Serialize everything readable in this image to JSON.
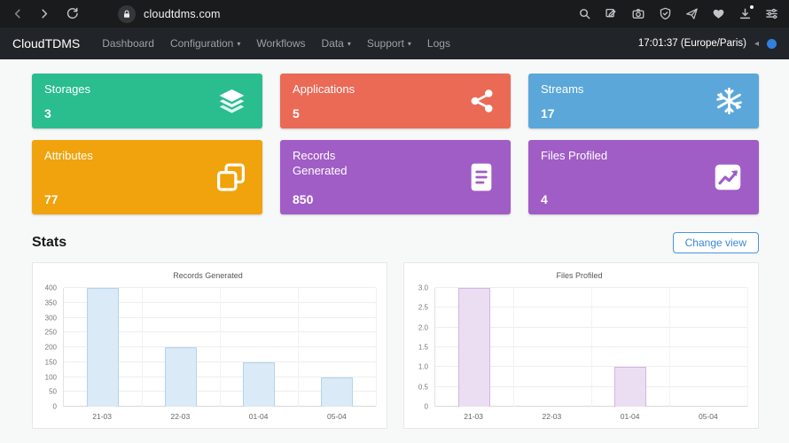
{
  "browser": {
    "url": "cloudtdms.com",
    "icons": [
      "back",
      "forward",
      "refresh",
      "lock",
      "search",
      "screenshot-edit",
      "camera",
      "shield",
      "send",
      "favorite",
      "download",
      "settings-sliders"
    ]
  },
  "navbar": {
    "brand": "CloudTDMS",
    "items": [
      {
        "label": "Dashboard"
      },
      {
        "label": "Configuration"
      },
      {
        "label": "Workflows"
      },
      {
        "label": "Data"
      },
      {
        "label": "Support"
      },
      {
        "label": "Logs"
      }
    ],
    "clock": "17:01:37 (Europe/Paris)"
  },
  "cards": [
    {
      "title": "Storages",
      "value": "3",
      "color": "#2abd8e",
      "icon": "layers-icon"
    },
    {
      "title": "Applications",
      "value": "5",
      "color": "#ea6a56",
      "icon": "nodes-icon"
    },
    {
      "title": "Streams",
      "value": "17",
      "color": "#5ba7da",
      "icon": "snowflake-icon"
    },
    {
      "title": "Attributes",
      "value": "77",
      "color": "#f0a30c",
      "icon": "clone-icon"
    },
    {
      "title": "Records Generated",
      "value": "850",
      "color": "#a05dc6",
      "icon": "file-text-icon"
    },
    {
      "title": "Files Profiled",
      "value": "4",
      "color": "#a05dc6",
      "icon": "chart-line-icon"
    }
  ],
  "stats": {
    "heading": "Stats",
    "change_view_label": "Change view"
  },
  "chart_data": [
    {
      "type": "bar",
      "title": "Records Generated",
      "categories": [
        "21-03",
        "22-03",
        "01-04",
        "05-04"
      ],
      "values": [
        400,
        200,
        150,
        100
      ],
      "ylim": [
        0,
        400
      ],
      "ytick_step": 50,
      "bar_fill": "#dbeaf7",
      "bar_border": "#b3d4ea",
      "grid": true,
      "legend": "none"
    },
    {
      "type": "bar",
      "title": "Files Profiled",
      "categories": [
        "21-03",
        "22-03",
        "01-04",
        "05-04"
      ],
      "values": [
        3,
        0,
        1,
        0
      ],
      "ylim": [
        0,
        3
      ],
      "ytick_step": 0.5,
      "bar_fill": "#ecdef2",
      "bar_border": "#d4b4e2",
      "grid": true,
      "legend": "none"
    }
  ]
}
